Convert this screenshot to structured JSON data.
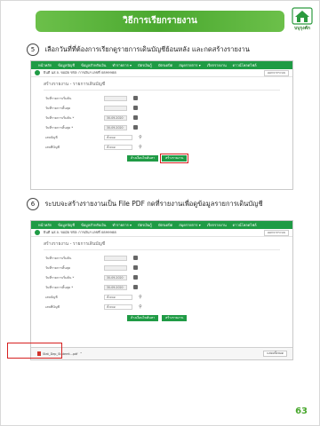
{
  "header": {
    "title": "วิธีการเรียกรายงาน",
    "logo_text": "บบุรุงคัก"
  },
  "steps": [
    {
      "number": "5",
      "text": "เลือกวันที่ที่ต้องการเรียกดูรายการเดินบัญชีย้อนหลัง และกดสร้างรายงาน"
    },
    {
      "number": "6",
      "text": "ระบบจะสร้างรายงานเป็น File PDF กดที่รายงานเพื่อดูข้อมูลรายการเดินบัญชี"
    }
  ],
  "app": {
    "nav_items": [
      "หน้าหลัก",
      "ข้อมูลบัญชี",
      "ข้อมูลสำหรับเงิน",
      "ทำรายการ ▾",
      "บัตรเงินกู้",
      "บัตรเดบิต",
      "สมุดรายการ ▾",
      "เรียกรายงาน",
      "ดาวน์โหลดไฟล์"
    ],
    "user_text": "ยินดี  นส.จ. ขอมัย  รหัส: การเงินฯ  เลขที่ 0899988",
    "logout_label": "ออกจากระบบ",
    "form_title": "สร้างรายงาน - รายการเดินบัญชี",
    "fields": [
      {
        "label": "วันที่รายการเริ่มต้น",
        "value": ""
      },
      {
        "label": "วันที่รายการสิ้นสุด",
        "value": ""
      },
      {
        "label": "วันที่รายการเริ่มต้น *",
        "value": "30-09-2020"
      },
      {
        "label": "วันที่รายการสิ้นสุด *",
        "value": "30-09-2020"
      },
      {
        "label": "เลขบัญชี",
        "value": "ทั้งหมด"
      },
      {
        "label": "เลขที่บัญชี",
        "value": "ทั้งหมด"
      }
    ],
    "clear_button": "ล้างเงื่อนไขค้นหา",
    "create_button": "สร้างรายงาน",
    "download_file": "Stat_Dep_Statemt...pdf",
    "show_all_label": "แสดงทั้งหมด"
  },
  "page_number": "63",
  "colors": {
    "accent": "#1f9b45",
    "banner": "#4aa82f",
    "highlight": "#d62020"
  }
}
